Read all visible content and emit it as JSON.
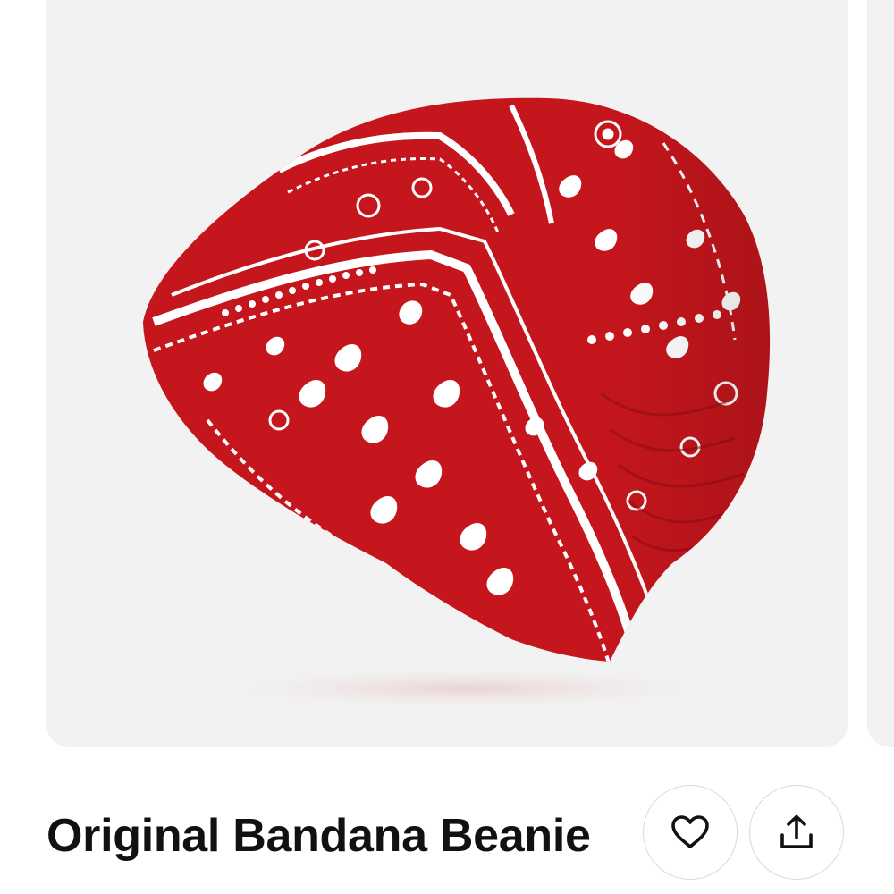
{
  "product": {
    "title": "Original Bandana Beanie",
    "image": {
      "subject": "red paisley bandana beanie",
      "fabric_color": "#c4161c",
      "pattern_color": "#ffffff",
      "background_color": "#f2f2f2"
    }
  },
  "actions": {
    "favorite": {
      "icon": "heart-icon"
    },
    "share": {
      "icon": "share-icon"
    }
  }
}
